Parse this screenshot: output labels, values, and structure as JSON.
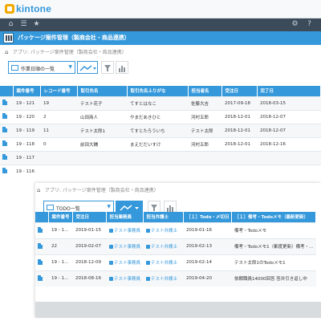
{
  "header": {
    "logo_text": "kintone"
  },
  "globalnav": {
    "icons": [
      "home-icon",
      "list-icon",
      "star-icon",
      "gear-icon",
      "help-icon"
    ]
  },
  "app": {
    "title": "パッケージ案件管理（製商会社・商品連携）"
  },
  "back": {
    "breadcrumb": "アプリ: パッケージ案件管理（製商会社・商品連携）",
    "view_label": "作業日順の一覧",
    "columns": [
      "案件番号",
      "レコード番号",
      "取引先名",
      "取引先名ふりがな",
      "担当者名",
      "受注日",
      "完了日"
    ],
    "rows": [
      [
        "19 - 121",
        "19",
        "テスト花子",
        "てすとはなこ",
        "佐藤大吉",
        "2017-09-18",
        "2018-03-15"
      ],
      [
        "19 - 120",
        "2",
        "山田商人",
        "やまだあきひと",
        "河村五郎",
        "2018-12-01",
        "2018-12-07"
      ],
      [
        "19 - 119",
        "11",
        "テスト太郎1",
        "てすとたろういち",
        "テスト太郎",
        "2018-12-01",
        "2018-12-07"
      ],
      [
        "19 - 118",
        "0",
        "前田大輔",
        "まえだだいすけ",
        "河村五郎",
        "2018-12-01",
        "2018-12-16"
      ],
      [
        "19 - 117",
        "",
        "",
        "",
        "",
        "",
        ""
      ],
      [
        "19 - 116",
        "",
        "",
        "",
        "",
        "",
        ""
      ]
    ]
  },
  "front": {
    "breadcrumb": "アプリ: パッケージ案件管理（製商会社・商品連携）",
    "view_label": "TODO一覧",
    "columns": [
      "案件番号",
      "受注日",
      "担当業務員",
      "担当弁護士",
      "［１］Todo・〆切日",
      "［１］備考・Todoメモ（最新更新）"
    ],
    "rows": [
      [
        "19 - 1…",
        "2019-01-15",
        "テスト事務員",
        "テスト弁護士",
        "2019-01-16",
        "備考・Todoメモ"
      ],
      [
        "22",
        "2019-02-07",
        "テスト事務員",
        "テスト弁護士",
        "2019-02-13",
        "備考・Todoメモ1（都度更新）備考・…"
      ],
      [
        "19 - 1…",
        "2018-12-09",
        "テスト事務員",
        "テスト弁護士",
        "2019-02-14",
        "テスト太郎1のTodoメモ1"
      ],
      [
        "19 - 1…",
        "2018-08-16",
        "テスト事務員",
        "テスト弁護士",
        "2019-04-20",
        "依頼職員14000回答 答弁引き返し中"
      ]
    ]
  },
  "colors": {
    "accent": "#3498db",
    "nav": "#3b4b5a",
    "logo": "#f2a900"
  }
}
